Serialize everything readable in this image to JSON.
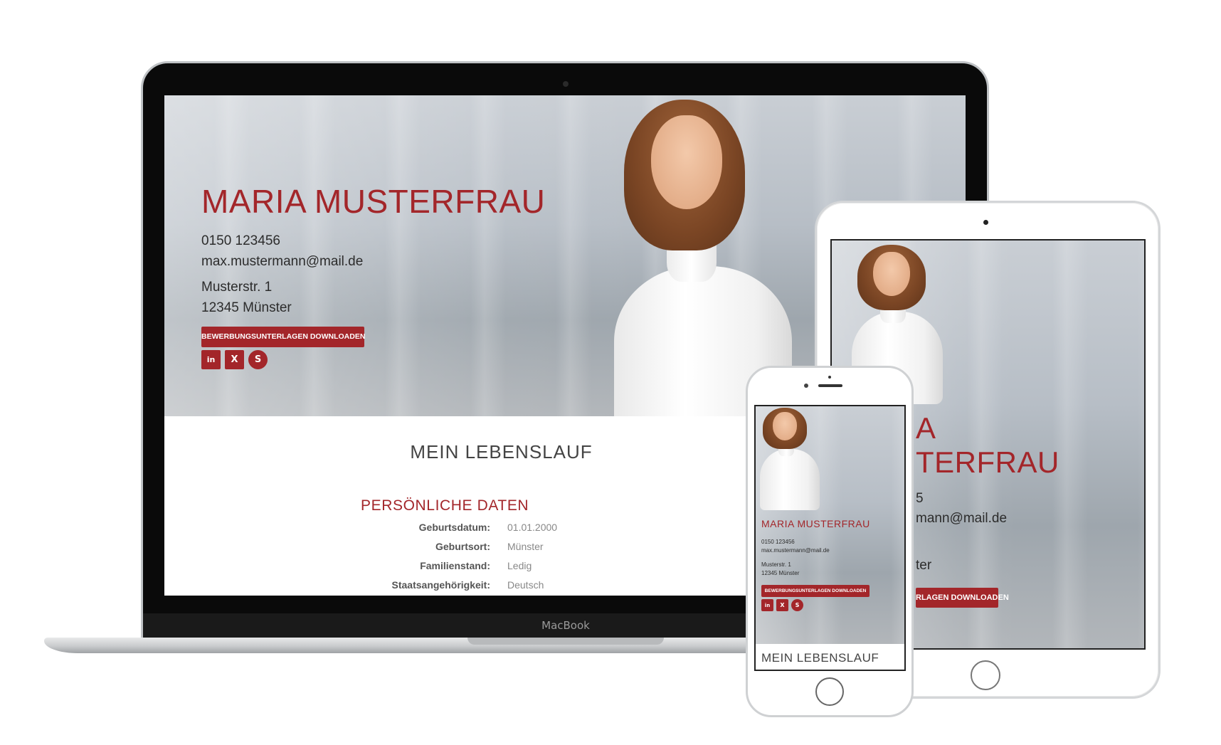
{
  "profile": {
    "name": "MARIA MUSTERFRAU",
    "phone": "0150 123456",
    "email": "max.mustermann@mail.de",
    "street": "Musterstr. 1",
    "city": "12345 Münster",
    "download_label": "BEWERBUNGSUNTERLAGEN DOWNLOADEN",
    "social": [
      {
        "icon": "linkedin-icon",
        "glyph": "in"
      },
      {
        "icon": "xing-icon",
        "glyph": "X"
      },
      {
        "icon": "skype-icon",
        "glyph": "S"
      }
    ]
  },
  "resume": {
    "title": "MEIN LEBENSLAUF",
    "personal_title": "PERSÖNLICHE DATEN",
    "personal_rows": [
      {
        "label": "Geburtsdatum:",
        "value": "01.01.2000"
      },
      {
        "label": "Geburtsort:",
        "value": "Münster"
      },
      {
        "label": "Familienstand:",
        "value": "Ledig"
      },
      {
        "label": "Staatsangehörigkeit:",
        "value": "Deutsch"
      }
    ]
  },
  "devices": {
    "laptop_label": "MacBook"
  },
  "tablet": {
    "name_line1": "A",
    "name_line2": "TERFRAU",
    "phone_fragment": "5",
    "email_fragment": "mann@mail.de",
    "city_fragment": "ter",
    "download_fragment": "RLAGEN DOWNLOADEN"
  },
  "colors": {
    "accent": "#a3262a",
    "text_dark": "#2c2c2c"
  }
}
